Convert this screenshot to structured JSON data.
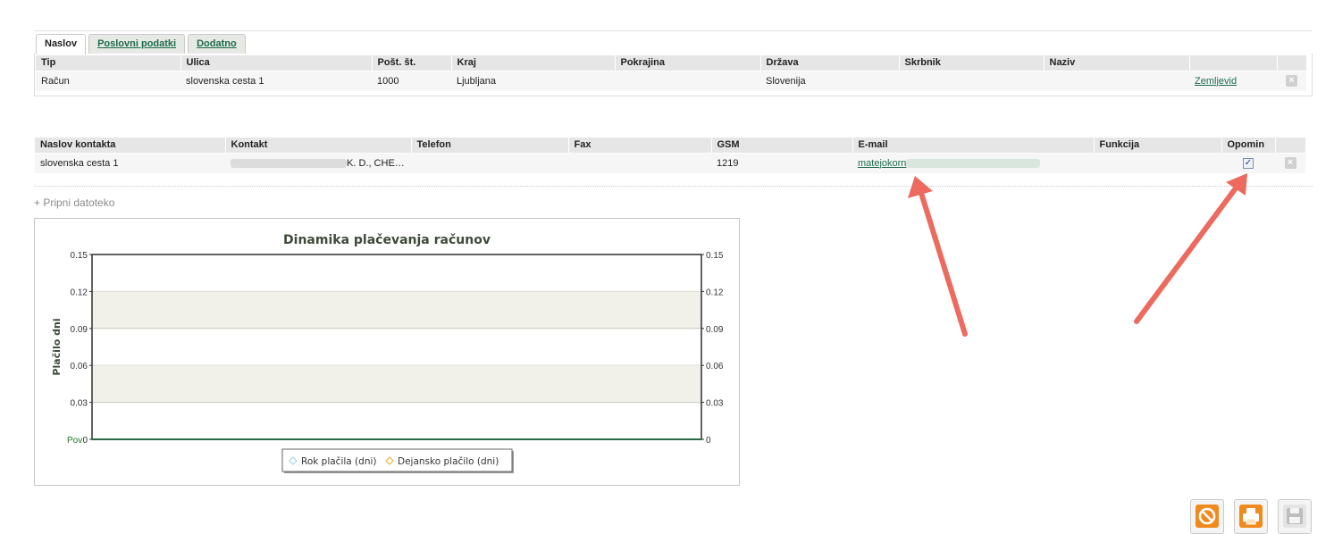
{
  "tabs": [
    {
      "label": "Naslov",
      "active": true
    },
    {
      "label": "Poslovni podatki",
      "active": false
    },
    {
      "label": "Dodatno",
      "active": false
    }
  ],
  "address_table": {
    "headers": [
      "Tip",
      "Ulica",
      "Pošt. št.",
      "Kraj",
      "Pokrajina",
      "Država",
      "Skrbnik",
      "Naziv",
      "",
      ""
    ],
    "row": {
      "tip": "Račun",
      "ulica": "slovenska cesta 1",
      "post": "1000",
      "kraj": "Ljubljana",
      "pokrajina": "",
      "drzava": "Slovenija",
      "skrbnik": "",
      "naziv": "",
      "link": "Zemljevid"
    }
  },
  "contact_table": {
    "headers": [
      "Naslov kontakta",
      "Kontakt",
      "Telefon",
      "Fax",
      "GSM",
      "E-mail",
      "Funkcija",
      "Opomin",
      ""
    ],
    "row": {
      "naslov": "slovenska cesta 1",
      "kontakt_suffix": "K. D., CHE…",
      "telefon": "",
      "fax": "",
      "gsm": "1219",
      "email_visible": "matejokorn",
      "funkcija": "",
      "opomin_checked": true
    }
  },
  "attach_label": "+ Pripni datoteko",
  "chart_data": {
    "type": "line",
    "title": "Dinamika plačevanja računov",
    "ylabel": "Plačilo dni",
    "ylim": [
      0,
      0.15
    ],
    "yticks": [
      "0.15",
      "0.12",
      "0.09",
      "0.06",
      "0.03",
      "0"
    ],
    "yticks_right": [
      "0.15",
      "0.12",
      "0.09",
      "0.06",
      "0.03",
      "0"
    ],
    "categories": [
      "Pov"
    ],
    "series": [
      {
        "name": "Rok plačila (dni)",
        "color": "#a9d4f0",
        "values": [
          0
        ]
      },
      {
        "name": "Dejansko plačilo (dni)",
        "color": "#f0b84a",
        "values": [
          0
        ]
      }
    ],
    "band_color": "#f1f1e9",
    "grid": true,
    "legend": "bottom"
  },
  "colors": {
    "link": "#1c6b4d",
    "arrow": "#ec6a5e",
    "cancel_btn": "#f08a1c",
    "print_btn": "#f08a1c",
    "save_btn": "#d6d6d6"
  },
  "icons": {
    "delete": "close-icon",
    "cancel": "cancel-icon",
    "print": "print-icon",
    "save": "save-icon"
  }
}
